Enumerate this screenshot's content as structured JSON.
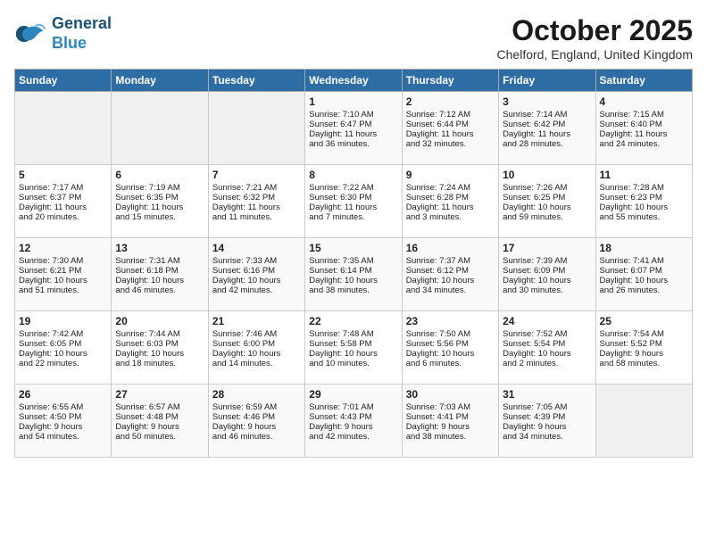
{
  "header": {
    "logo_line1": "General",
    "logo_line2": "Blue",
    "month": "October 2025",
    "location": "Chelford, England, United Kingdom"
  },
  "days_of_week": [
    "Sunday",
    "Monday",
    "Tuesday",
    "Wednesday",
    "Thursday",
    "Friday",
    "Saturday"
  ],
  "weeks": [
    [
      {
        "day": "",
        "data": ""
      },
      {
        "day": "",
        "data": ""
      },
      {
        "day": "",
        "data": ""
      },
      {
        "day": "1",
        "data": "Sunrise: 7:10 AM\nSunset: 6:47 PM\nDaylight: 11 hours\nand 36 minutes."
      },
      {
        "day": "2",
        "data": "Sunrise: 7:12 AM\nSunset: 6:44 PM\nDaylight: 11 hours\nand 32 minutes."
      },
      {
        "day": "3",
        "data": "Sunrise: 7:14 AM\nSunset: 6:42 PM\nDaylight: 11 hours\nand 28 minutes."
      },
      {
        "day": "4",
        "data": "Sunrise: 7:15 AM\nSunset: 6:40 PM\nDaylight: 11 hours\nand 24 minutes."
      }
    ],
    [
      {
        "day": "5",
        "data": "Sunrise: 7:17 AM\nSunset: 6:37 PM\nDaylight: 11 hours\nand 20 minutes."
      },
      {
        "day": "6",
        "data": "Sunrise: 7:19 AM\nSunset: 6:35 PM\nDaylight: 11 hours\nand 15 minutes."
      },
      {
        "day": "7",
        "data": "Sunrise: 7:21 AM\nSunset: 6:32 PM\nDaylight: 11 hours\nand 11 minutes."
      },
      {
        "day": "8",
        "data": "Sunrise: 7:22 AM\nSunset: 6:30 PM\nDaylight: 11 hours\nand 7 minutes."
      },
      {
        "day": "9",
        "data": "Sunrise: 7:24 AM\nSunset: 6:28 PM\nDaylight: 11 hours\nand 3 minutes."
      },
      {
        "day": "10",
        "data": "Sunrise: 7:26 AM\nSunset: 6:25 PM\nDaylight: 10 hours\nand 59 minutes."
      },
      {
        "day": "11",
        "data": "Sunrise: 7:28 AM\nSunset: 6:23 PM\nDaylight: 10 hours\nand 55 minutes."
      }
    ],
    [
      {
        "day": "12",
        "data": "Sunrise: 7:30 AM\nSunset: 6:21 PM\nDaylight: 10 hours\nand 51 minutes."
      },
      {
        "day": "13",
        "data": "Sunrise: 7:31 AM\nSunset: 6:18 PM\nDaylight: 10 hours\nand 46 minutes."
      },
      {
        "day": "14",
        "data": "Sunrise: 7:33 AM\nSunset: 6:16 PM\nDaylight: 10 hours\nand 42 minutes."
      },
      {
        "day": "15",
        "data": "Sunrise: 7:35 AM\nSunset: 6:14 PM\nDaylight: 10 hours\nand 38 minutes."
      },
      {
        "day": "16",
        "data": "Sunrise: 7:37 AM\nSunset: 6:12 PM\nDaylight: 10 hours\nand 34 minutes."
      },
      {
        "day": "17",
        "data": "Sunrise: 7:39 AM\nSunset: 6:09 PM\nDaylight: 10 hours\nand 30 minutes."
      },
      {
        "day": "18",
        "data": "Sunrise: 7:41 AM\nSunset: 6:07 PM\nDaylight: 10 hours\nand 26 minutes."
      }
    ],
    [
      {
        "day": "19",
        "data": "Sunrise: 7:42 AM\nSunset: 6:05 PM\nDaylight: 10 hours\nand 22 minutes."
      },
      {
        "day": "20",
        "data": "Sunrise: 7:44 AM\nSunset: 6:03 PM\nDaylight: 10 hours\nand 18 minutes."
      },
      {
        "day": "21",
        "data": "Sunrise: 7:46 AM\nSunset: 6:00 PM\nDaylight: 10 hours\nand 14 minutes."
      },
      {
        "day": "22",
        "data": "Sunrise: 7:48 AM\nSunset: 5:58 PM\nDaylight: 10 hours\nand 10 minutes."
      },
      {
        "day": "23",
        "data": "Sunrise: 7:50 AM\nSunset: 5:56 PM\nDaylight: 10 hours\nand 6 minutes."
      },
      {
        "day": "24",
        "data": "Sunrise: 7:52 AM\nSunset: 5:54 PM\nDaylight: 10 hours\nand 2 minutes."
      },
      {
        "day": "25",
        "data": "Sunrise: 7:54 AM\nSunset: 5:52 PM\nDaylight: 9 hours\nand 58 minutes."
      }
    ],
    [
      {
        "day": "26",
        "data": "Sunrise: 6:55 AM\nSunset: 4:50 PM\nDaylight: 9 hours\nand 54 minutes."
      },
      {
        "day": "27",
        "data": "Sunrise: 6:57 AM\nSunset: 4:48 PM\nDaylight: 9 hours\nand 50 minutes."
      },
      {
        "day": "28",
        "data": "Sunrise: 6:59 AM\nSunset: 4:46 PM\nDaylight: 9 hours\nand 46 minutes."
      },
      {
        "day": "29",
        "data": "Sunrise: 7:01 AM\nSunset: 4:43 PM\nDaylight: 9 hours\nand 42 minutes."
      },
      {
        "day": "30",
        "data": "Sunrise: 7:03 AM\nSunset: 4:41 PM\nDaylight: 9 hours\nand 38 minutes."
      },
      {
        "day": "31",
        "data": "Sunrise: 7:05 AM\nSunset: 4:39 PM\nDaylight: 9 hours\nand 34 minutes."
      },
      {
        "day": "",
        "data": ""
      }
    ]
  ]
}
